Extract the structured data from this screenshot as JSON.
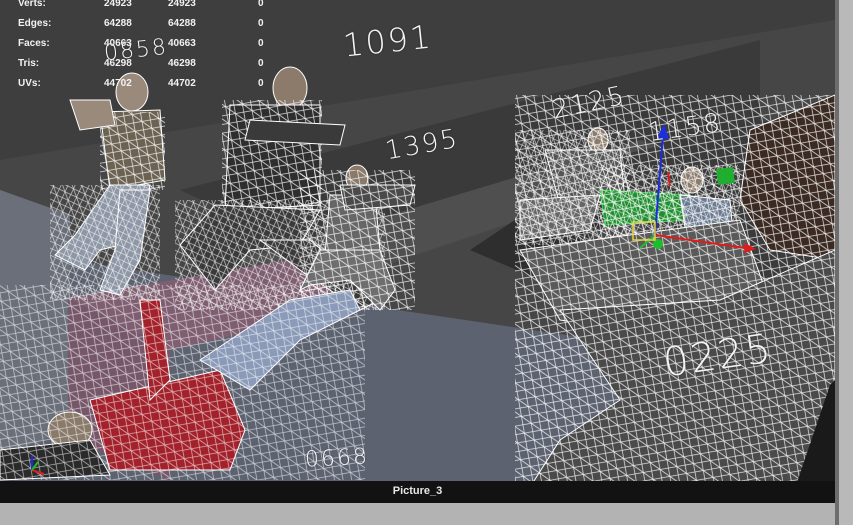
{
  "stats": [
    {
      "label": "Verts:",
      "v1": "24923",
      "v2": "24923",
      "v3": "0"
    },
    {
      "label": "Edges:",
      "v1": "64288",
      "v2": "64288",
      "v3": "0"
    },
    {
      "label": "Faces:",
      "v1": "40663",
      "v2": "40663",
      "v3": "0"
    },
    {
      "label": "Tris:",
      "v1": "46298",
      "v2": "46298",
      "v3": "0"
    },
    {
      "label": "UVs:",
      "v1": "44702",
      "v2": "44702",
      "v3": "0"
    }
  ],
  "annotations": [
    "0858",
    "1091",
    "1395",
    "2125",
    "1158",
    "0225",
    "0668"
  ],
  "caption": "Picture_3",
  "colors": {
    "wireframe": "#ffffff",
    "x_axis": "#e01b1b",
    "y_axis": "#1b2fe0",
    "z_axis": "#1bbf2a",
    "selected_mesh": "#1f8f2f",
    "floor": "#5c6270",
    "pink_block": "#7e5e70"
  }
}
